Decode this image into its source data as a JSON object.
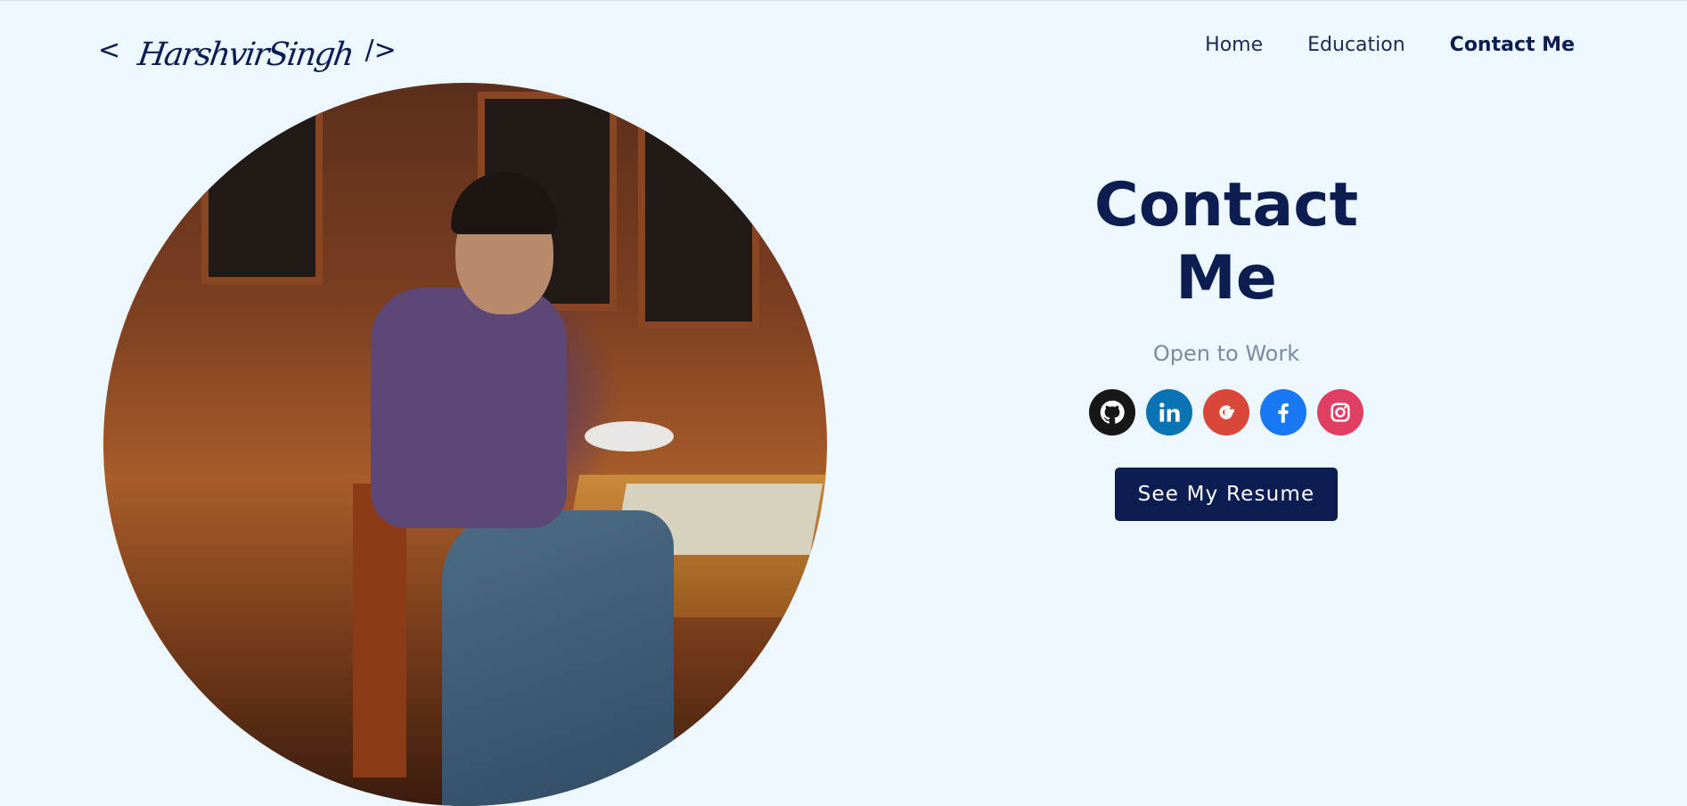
{
  "header": {
    "logo_open": "<",
    "logo_signature": "HarshvirSingh",
    "logo_close": "/>",
    "nav": [
      {
        "label": "Home"
      },
      {
        "label": "Education"
      },
      {
        "label": "Contact Me"
      }
    ]
  },
  "contact": {
    "title": "Contact Me",
    "subtitle": "Open to Work",
    "resume_label": "See My Resume",
    "socials": [
      {
        "name": "github-icon",
        "color": "#181717"
      },
      {
        "name": "linkedin-icon",
        "color": "#0a73b4"
      },
      {
        "name": "google-icon",
        "color": "#d9473a"
      },
      {
        "name": "facebook-icon",
        "color": "#1877f2"
      },
      {
        "name": "instagram-icon",
        "color": "#e23e63"
      }
    ]
  },
  "colors": {
    "background": "#edf7fe",
    "primary": "#0b1d51",
    "muted": "#7d8aa2"
  }
}
